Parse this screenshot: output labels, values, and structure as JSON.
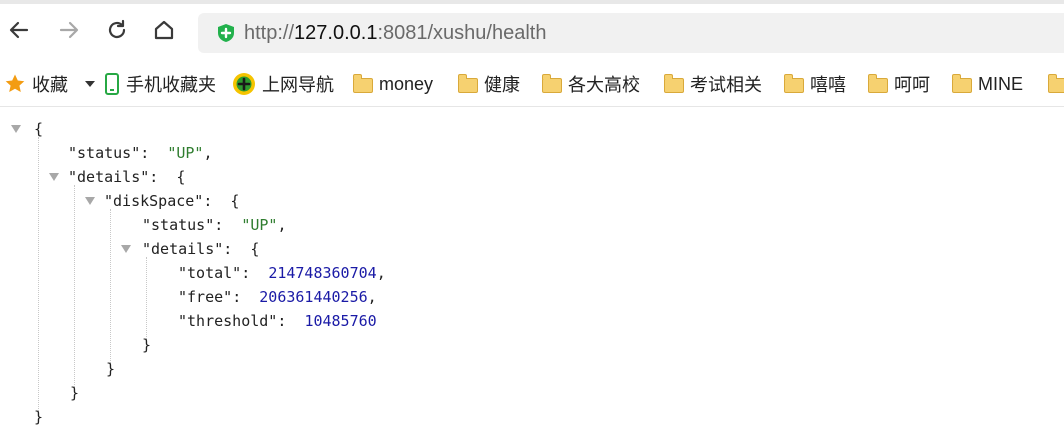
{
  "browser": {
    "url_scheme": "http://",
    "url_host": "127.0.0.1",
    "url_rest": ":8081/xushu/health",
    "icons": {
      "back": "back-arrow-icon",
      "forward": "forward-arrow-icon",
      "reload": "reload-icon",
      "home": "home-icon",
      "security": "shield-plus-icon"
    },
    "colors": {
      "shield": "#22b14c",
      "star": "#f39c12",
      "folder": "#f6d170"
    }
  },
  "bookmarks": {
    "favorites": "收藏",
    "mobile": "手机收藏夹",
    "nav": "上网导航",
    "items": [
      "money",
      "健康",
      "各大高校",
      "考试相关",
      "嘻嘻",
      "呵呵",
      "MINE"
    ]
  },
  "json_view": {
    "open_brace": "{",
    "close_brace": "}",
    "key_status": "\"status\"",
    "val_status": "\"UP\"",
    "key_details": "\"details\"",
    "key_diskspace": "\"diskSpace\"",
    "key_disk_status": "\"status\"",
    "val_disk_status": "\"UP\"",
    "key_disk_details": "\"details\"",
    "key_total": "\"total\"",
    "val_total": "214748360704",
    "key_free": "\"free\"",
    "val_free": "206361440256",
    "key_threshold": "\"threshold\"",
    "val_threshold": "10485760"
  }
}
